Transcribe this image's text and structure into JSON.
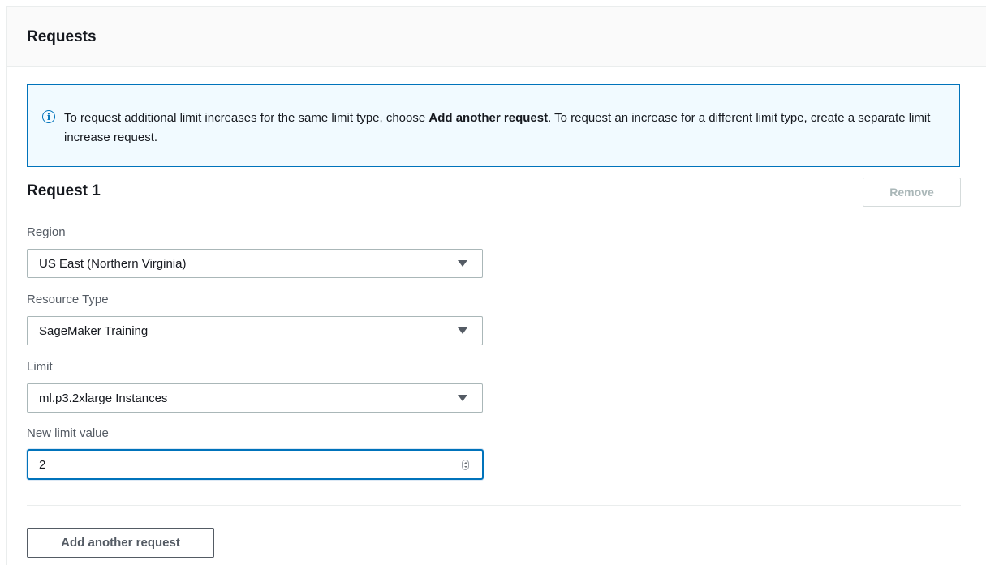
{
  "panel": {
    "title": "Requests"
  },
  "info": {
    "icon": "info-icon",
    "icon_glyph": "i",
    "text_before": "To request additional limit increases for the same limit type, choose ",
    "bold_text": "Add another request",
    "text_after": ". To request an increase for a different limit type, create a separate limit increase request."
  },
  "request": {
    "title": "Request 1",
    "remove_label": "Remove",
    "region": {
      "label": "Region",
      "value": "US East (Northern Virginia)"
    },
    "resource_type": {
      "label": "Resource Type",
      "value": "SageMaker Training"
    },
    "limit": {
      "label": "Limit",
      "value": "ml.p3.2xlarge Instances"
    },
    "new_limit_value": {
      "label": "New limit value",
      "value": "2"
    }
  },
  "actions": {
    "add_another_label": "Add another request"
  },
  "colors": {
    "accent": "#0073bb",
    "info_background": "#f1faff",
    "header_background": "#fafafa",
    "disabled_text": "#aab7b8"
  }
}
